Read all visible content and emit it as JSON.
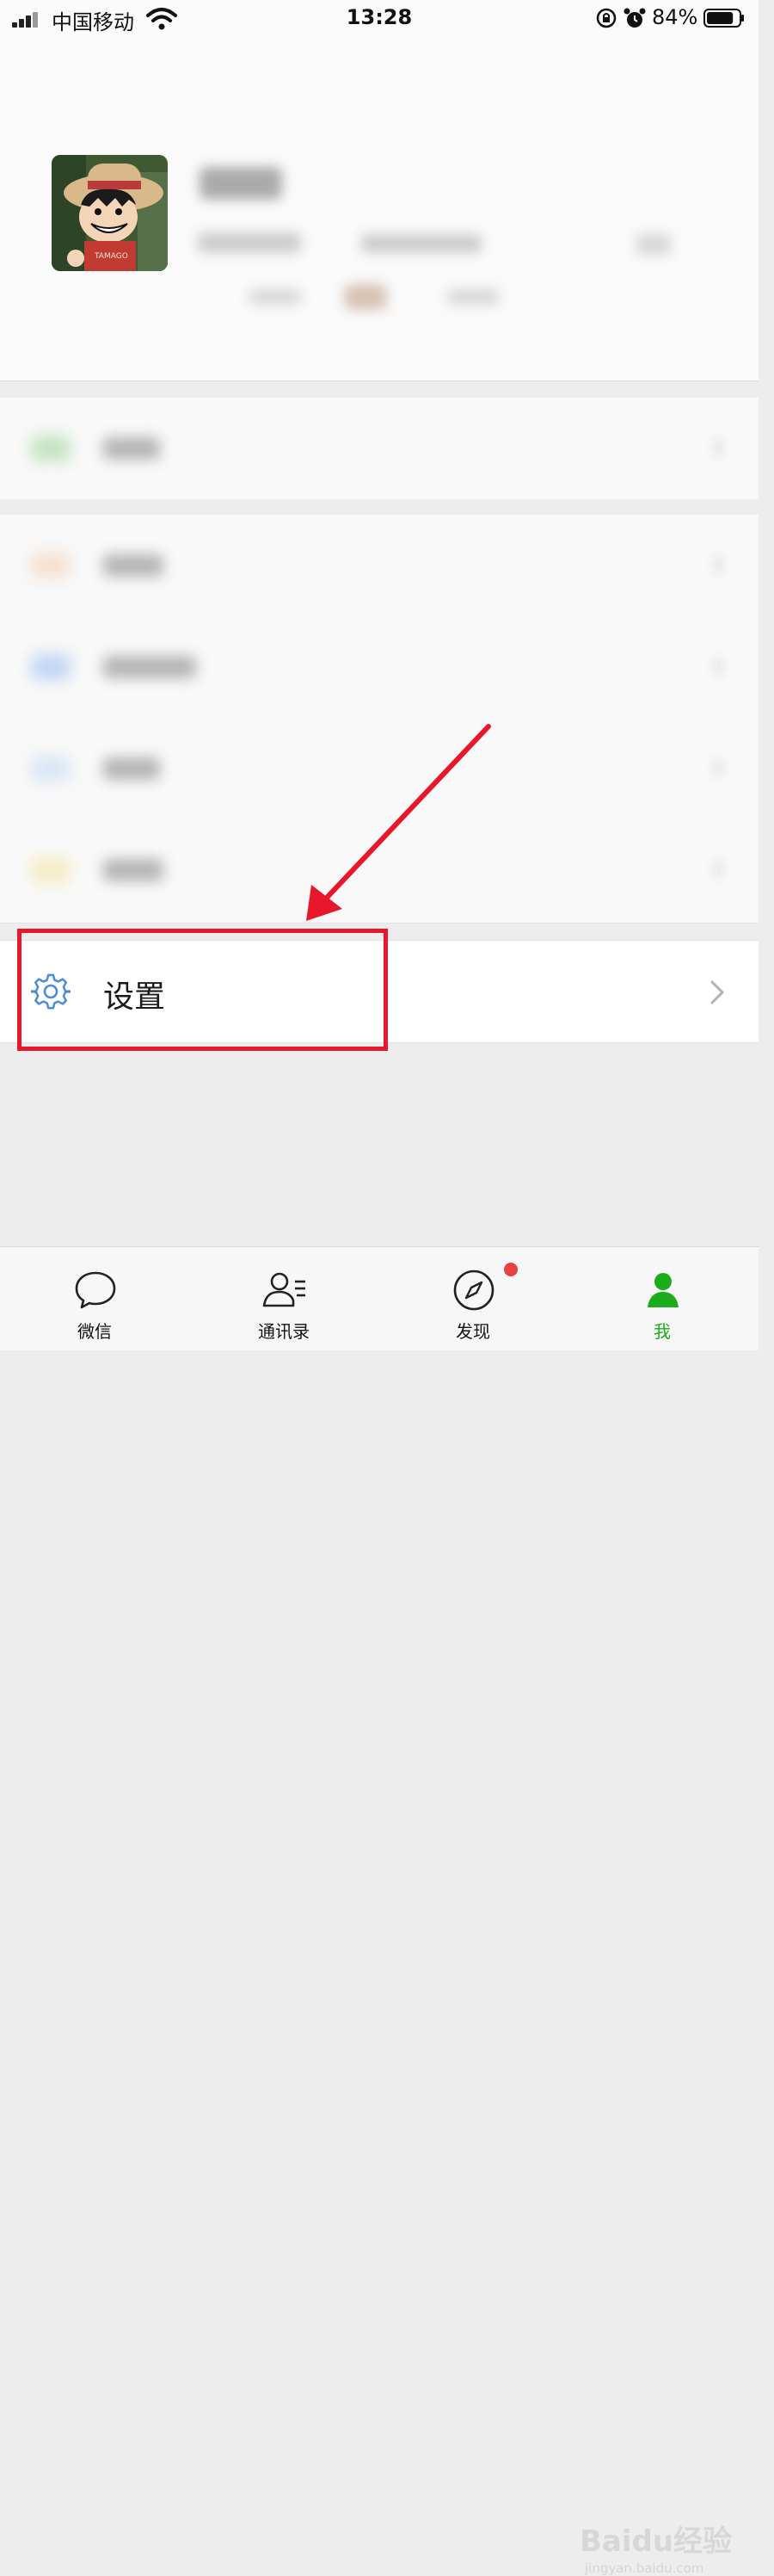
{
  "status_bar": {
    "carrier": "中国移动",
    "time": "13:28",
    "battery_percent": "84%",
    "battery_level": 0.84,
    "icons": [
      "signal-icon",
      "wifi-icon",
      "orientation-lock-icon",
      "alarm-icon",
      "battery-icon"
    ]
  },
  "settings": {
    "label": "设置",
    "icon": "gear-icon",
    "accent": "#4a8ed8"
  },
  "annotation": {
    "color": "#e8172b"
  },
  "tab_bar": {
    "tabs": [
      {
        "label": "微信",
        "icon": "chat-bubble-icon"
      },
      {
        "label": "通讯录",
        "icon": "contacts-icon"
      },
      {
        "label": "发现",
        "icon": "compass-icon",
        "badge": true
      },
      {
        "label": "我",
        "icon": "me-icon",
        "active": true
      }
    ],
    "active_color": "#1aad19"
  },
  "watermark": {
    "text": "Baidu经验",
    "sub": "jingyan.baidu.com"
  }
}
